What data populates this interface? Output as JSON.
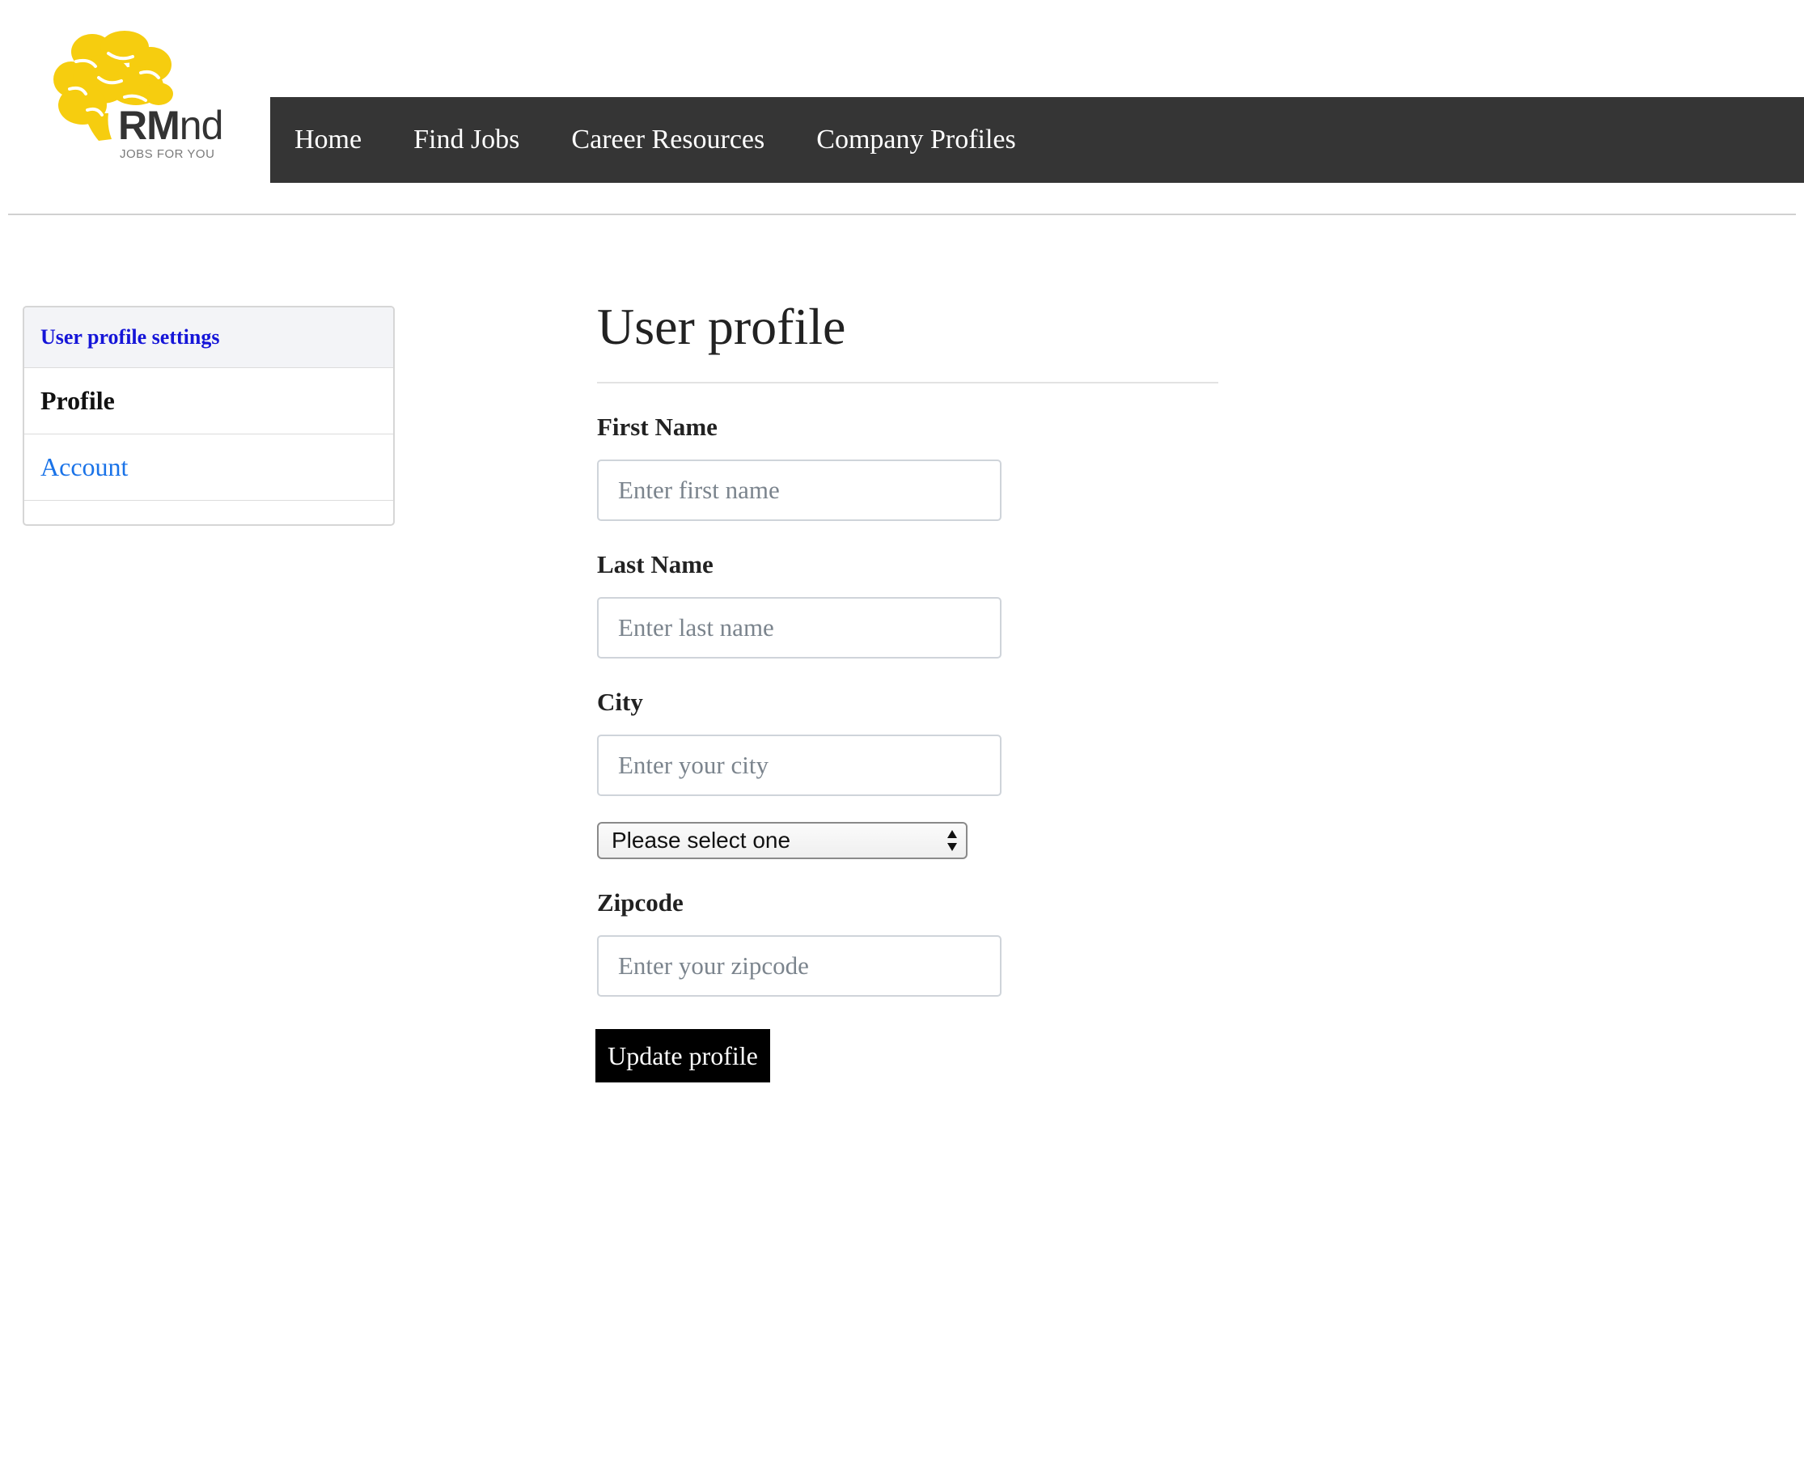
{
  "brand": {
    "name_bold": "RM",
    "name_rest": "nd",
    "tagline": "JOBS FOR YOU",
    "logo_icon": "brain-icon",
    "logo_color": "#f6cd0f"
  },
  "nav": {
    "items": [
      {
        "label": "Home"
      },
      {
        "label": "Find Jobs"
      },
      {
        "label": "Career Resources"
      },
      {
        "label": "Company Profiles"
      }
    ],
    "background": "#353535"
  },
  "sidebar": {
    "header": "User profile settings",
    "items": [
      {
        "label": "Profile",
        "active": true
      },
      {
        "label": "Account",
        "active": false
      }
    ]
  },
  "main": {
    "title": "User profile",
    "form": {
      "first_name": {
        "label": "First Name",
        "placeholder": "Enter first name",
        "value": ""
      },
      "last_name": {
        "label": "Last Name",
        "placeholder": "Enter last name",
        "value": ""
      },
      "city": {
        "label": "City",
        "placeholder": "Enter your city",
        "value": ""
      },
      "state_select": {
        "selected": "Please select one"
      },
      "zipcode": {
        "label": "Zipcode",
        "placeholder": "Enter your zipcode",
        "value": ""
      },
      "submit_label": "Update profile"
    }
  }
}
